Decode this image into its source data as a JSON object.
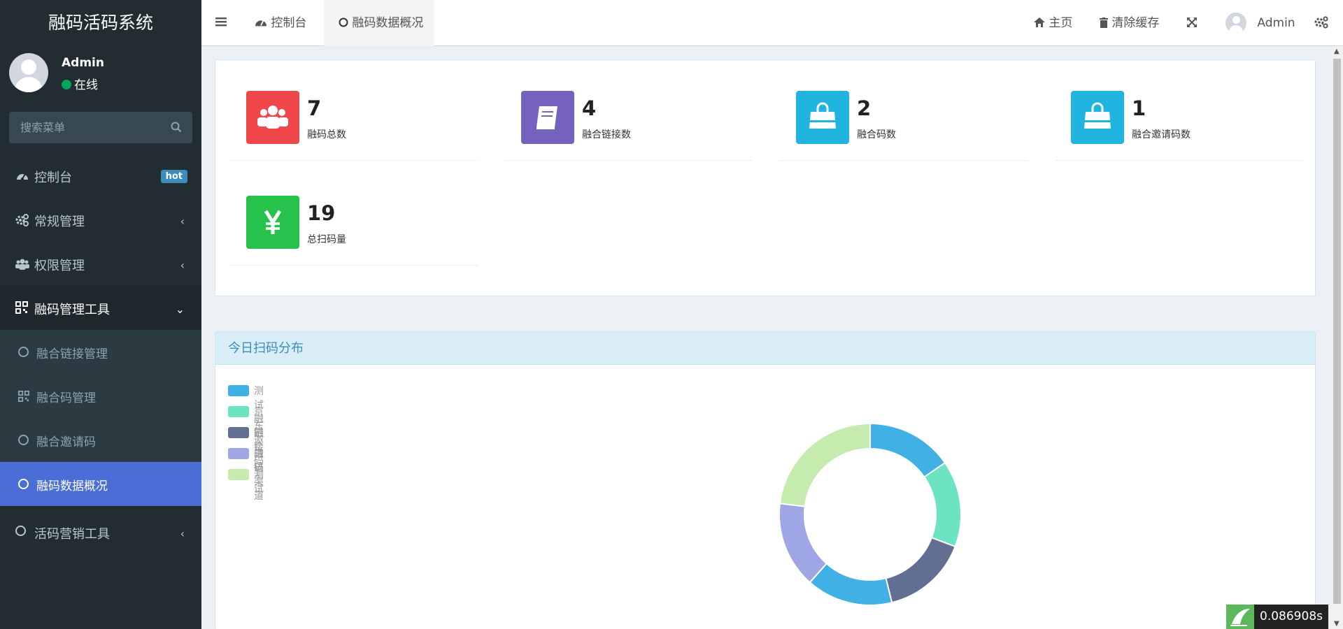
{
  "app": {
    "title": "融码活码系统"
  },
  "user": {
    "name": "Admin",
    "status": "在线"
  },
  "search": {
    "placeholder": "搜索菜单"
  },
  "menu": {
    "dashboard": {
      "label": "控制台",
      "badge": "hot"
    },
    "general": {
      "label": "常规管理"
    },
    "permission": {
      "label": "权限管理"
    },
    "tools": {
      "label": "融码管理工具",
      "children": [
        {
          "label": "融合链接管理"
        },
        {
          "label": "融合码管理"
        },
        {
          "label": "融合邀请码"
        },
        {
          "label": "融码数据概况"
        }
      ]
    },
    "marketing": {
      "label": "活码营销工具"
    }
  },
  "tabs": [
    {
      "label": "控制台"
    },
    {
      "label": "融码数据概况"
    }
  ],
  "header": {
    "home": "主页",
    "clear_cache": "清除缓存",
    "user": "Admin"
  },
  "stats": [
    {
      "value": "7",
      "label": "融码总数",
      "color": "#f0484a",
      "icon": "users-icon"
    },
    {
      "value": "4",
      "label": "融合链接数",
      "color": "#7462be",
      "icon": "book-icon"
    },
    {
      "value": "2",
      "label": "融合码数",
      "color": "#1fb5e0",
      "icon": "shopping-bag-icon"
    },
    {
      "value": "1",
      "label": "融合邀请码数",
      "color": "#1fb5e0",
      "icon": "shopping-bag-icon"
    },
    {
      "value": "19",
      "label": "总扫码量",
      "color": "#27c24c",
      "icon": "yen-icon"
    }
  ],
  "chart_panel": {
    "title": "今日扫码分布"
  },
  "chart_data": {
    "type": "pie",
    "legend_position": "top-left",
    "labels": [
      "测试融链接",
      "京东邀请码",
      "融合码测试",
      "融链渠道",
      "1"
    ],
    "colors": [
      "#41b0e4",
      "#6de4c1",
      "#626e92",
      "#9fa6e5",
      "#c6ebae"
    ],
    "slices": [
      {
        "label": "测试融链接",
        "value": 2
      },
      {
        "label": "京东邀请码",
        "value": 2
      },
      {
        "label": "融合码测试",
        "value": 2
      },
      {
        "label": "测试融链接",
        "value": 2
      },
      {
        "label": "融链渠道",
        "value": 2
      },
      {
        "label": "1",
        "value": 3
      }
    ]
  },
  "perf": {
    "value": "0.086908s"
  }
}
